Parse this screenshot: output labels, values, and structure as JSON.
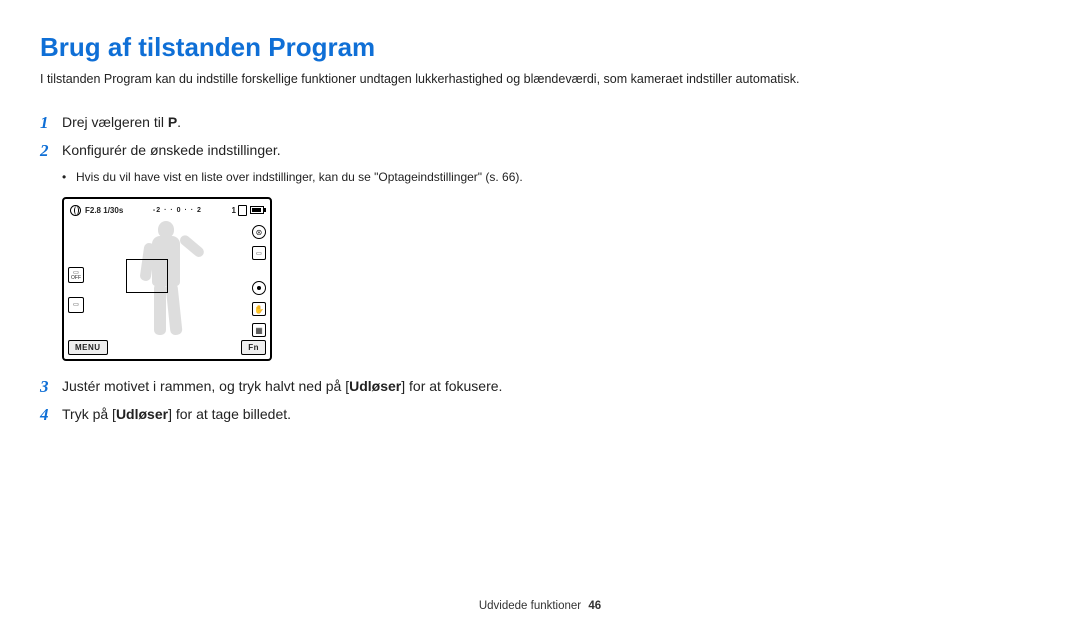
{
  "title": "Brug af tilstanden Program",
  "intro": "I tilstanden Program kan du indstille forskellige funktioner undtagen lukkerhastighed og blændeværdi, som kameraet indstiller automatisk.",
  "steps": {
    "s1": {
      "num": "1",
      "prefix": "Drej vælgeren til ",
      "mode": "P",
      "suffix": "."
    },
    "s2": {
      "num": "2",
      "text": "Konfigurér de ønskede indstillinger."
    },
    "bullet": {
      "text": "Hvis du vil have vist en liste over indstillinger, kan du se \"Optageindstillinger\" (s. 66)."
    },
    "s3": {
      "num": "3",
      "prefix": "Justér motivet i rammen, og tryk halvt ned på [",
      "bold": "Udløser",
      "suffix": "] for at fokusere."
    },
    "s4": {
      "num": "4",
      "prefix": "Tryk på [",
      "bold": "Udløser",
      "suffix": "] for at tage billedet."
    }
  },
  "camera": {
    "aperture": "F2.8",
    "shutter": "1/30s",
    "ev": "-2 · · 0 · · 2",
    "count": "1",
    "menu": "MENU",
    "fn": "Fn"
  },
  "footer": {
    "section": "Udvidede funktioner",
    "page": "46"
  }
}
